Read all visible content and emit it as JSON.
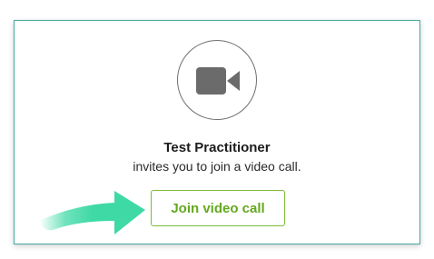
{
  "caller": {
    "name": "Test Practitioner",
    "message": "invites you to join a video call."
  },
  "actions": {
    "join_label": "Join video call"
  },
  "icons": {
    "camera": "video-camera-icon",
    "pointer": "arrow-right-icon"
  },
  "colors": {
    "card_border": "#4aa9a0",
    "button_text": "#64a81f",
    "button_border": "#7dbb3a",
    "arrow": "#3fd9a6",
    "camera_icon": "#6b6b6b"
  }
}
